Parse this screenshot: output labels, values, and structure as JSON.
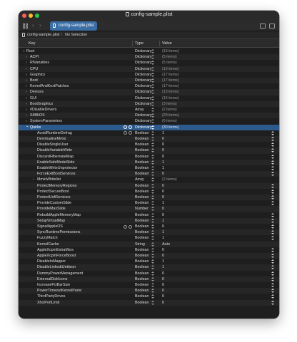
{
  "window": {
    "title": "config-sample.plist"
  },
  "toolbar": {
    "tab_label": "config-sample.plist"
  },
  "pathbar": {
    "file": "config-sample.plist",
    "separator": "〉",
    "selection": "No Selection"
  },
  "columns": {
    "key": "Key",
    "type": "Type",
    "value": "Value"
  },
  "rows": [
    {
      "key": "Root",
      "type": "Dictionary",
      "value": "(13 items)",
      "level": 0,
      "disclosure": "open"
    },
    {
      "key": "ACPI",
      "type": "Dictionary",
      "value": "(5 items)",
      "level": 1,
      "disclosure": "closed"
    },
    {
      "key": "RtVariables",
      "type": "Dictionary",
      "value": "(5 items)",
      "level": 1,
      "disclosure": "closed"
    },
    {
      "key": "CPU",
      "type": "Dictionary",
      "value": "(10 items)",
      "level": 1,
      "disclosure": "closed"
    },
    {
      "key": "Graphics",
      "type": "Dictionary",
      "value": "(17 items)",
      "level": 1,
      "disclosure": "closed"
    },
    {
      "key": "Boot",
      "type": "Dictionary",
      "value": "(17 items)",
      "level": 1,
      "disclosure": "closed"
    },
    {
      "key": "KernelAndKextPatches",
      "type": "Dictionary",
      "value": "(17 items)",
      "level": 1,
      "disclosure": "closed"
    },
    {
      "key": "Devices",
      "type": "Dictionary",
      "value": "(13 items)",
      "level": 1,
      "disclosure": "closed"
    },
    {
      "key": "GUI",
      "type": "Dictionary",
      "value": "(16 items)",
      "level": 1,
      "disclosure": "closed"
    },
    {
      "key": "BootGraphics",
      "type": "Dictionary",
      "value": "(3 items)",
      "level": 1,
      "disclosure": "closed"
    },
    {
      "key": "#DisableDrivers",
      "type": "Array",
      "value": "(2 items)",
      "level": 1,
      "disclosure": "closed"
    },
    {
      "key": "SMBIOS",
      "type": "Dictionary",
      "value": "(29 items)",
      "level": 1,
      "disclosure": "closed"
    },
    {
      "key": "SystemParameters",
      "type": "Dictionary",
      "value": "(6 items)",
      "level": 1,
      "disclosure": "closed"
    },
    {
      "key": "Quirks",
      "type": "Dictionary",
      "value": "(30 items)",
      "level": 1,
      "disclosure": "open",
      "selected": true
    },
    {
      "key": "AvoidRuntimeDefrag",
      "type": "Boolean",
      "value": "1",
      "level": 2,
      "buttons": true
    },
    {
      "key": "DevirtualiseMmio",
      "type": "Boolean",
      "value": "0",
      "level": 2
    },
    {
      "key": "DisableSingleUser",
      "type": "Boolean",
      "value": "0",
      "level": 2
    },
    {
      "key": "DisableVariableWrite",
      "type": "Boolean",
      "value": "0",
      "level": 2
    },
    {
      "key": "DiscardHibernateMap",
      "type": "Boolean",
      "value": "0",
      "level": 2
    },
    {
      "key": "EnableSafeModeSlide",
      "type": "Boolean",
      "value": "1",
      "level": 2
    },
    {
      "key": "EnableWriteUnprotector",
      "type": "Boolean",
      "value": "1",
      "level": 2
    },
    {
      "key": "ForceExitBootServices",
      "type": "Boolean",
      "value": "0",
      "level": 2
    },
    {
      "key": "MmioWhitelist",
      "type": "Array",
      "value": "(2 items)",
      "level": 2,
      "disclosure": "closed"
    },
    {
      "key": "ProtectMemoryRegions",
      "type": "Boolean",
      "value": "0",
      "level": 2
    },
    {
      "key": "ProtectSecureBoot",
      "type": "Boolean",
      "value": "0",
      "level": 2
    },
    {
      "key": "ProtectUefiServices",
      "type": "Boolean",
      "value": "0",
      "level": 2
    },
    {
      "key": "ProvideCustomSlide",
      "type": "Boolean",
      "value": "1",
      "level": 2
    },
    {
      "key": "ProvideMaxSlide",
      "type": "Number",
      "value": "0",
      "level": 2
    },
    {
      "key": "RebuildAppleMemoryMap",
      "type": "Boolean",
      "value": "0",
      "level": 2
    },
    {
      "key": "SetupVirtualMap",
      "type": "Boolean",
      "value": "1",
      "level": 2
    },
    {
      "key": "SignalAppleOS",
      "type": "Boolean",
      "value": "0",
      "level": 2,
      "buttons": true
    },
    {
      "key": "SyncRuntimePermissions",
      "type": "Boolean",
      "value": "1",
      "level": 2
    },
    {
      "key": "FuzzyMatch",
      "type": "Boolean",
      "value": "1",
      "level": 2
    },
    {
      "key": "KernelCache",
      "type": "String",
      "value": "Auto",
      "level": 2
    },
    {
      "key": "AppleXcpmExtraMsrs",
      "type": "Boolean",
      "value": "0",
      "level": 2
    },
    {
      "key": "AppleXcpmForceBoost",
      "type": "Boolean",
      "value": "0",
      "level": 2
    },
    {
      "key": "DisableIoMapper",
      "type": "Boolean",
      "value": "1",
      "level": 2
    },
    {
      "key": "DisableLinkeditJettison",
      "type": "Boolean",
      "value": "1",
      "level": 2
    },
    {
      "key": "DummyPowerManagement",
      "type": "Boolean",
      "value": "0",
      "level": 2
    },
    {
      "key": "ExternalDiskIcons",
      "type": "Boolean",
      "value": "0",
      "level": 2
    },
    {
      "key": "IncreasePciBarSize",
      "type": "Boolean",
      "value": "0",
      "level": 2
    },
    {
      "key": "PowerTimeoutKernelPanic",
      "type": "Boolean",
      "value": "0",
      "level": 2
    },
    {
      "key": "ThirdPartyDrives",
      "type": "Boolean",
      "value": "0",
      "level": 2
    },
    {
      "key": "XhciPortLimit",
      "type": "Boolean",
      "value": "0",
      "level": 2
    }
  ]
}
